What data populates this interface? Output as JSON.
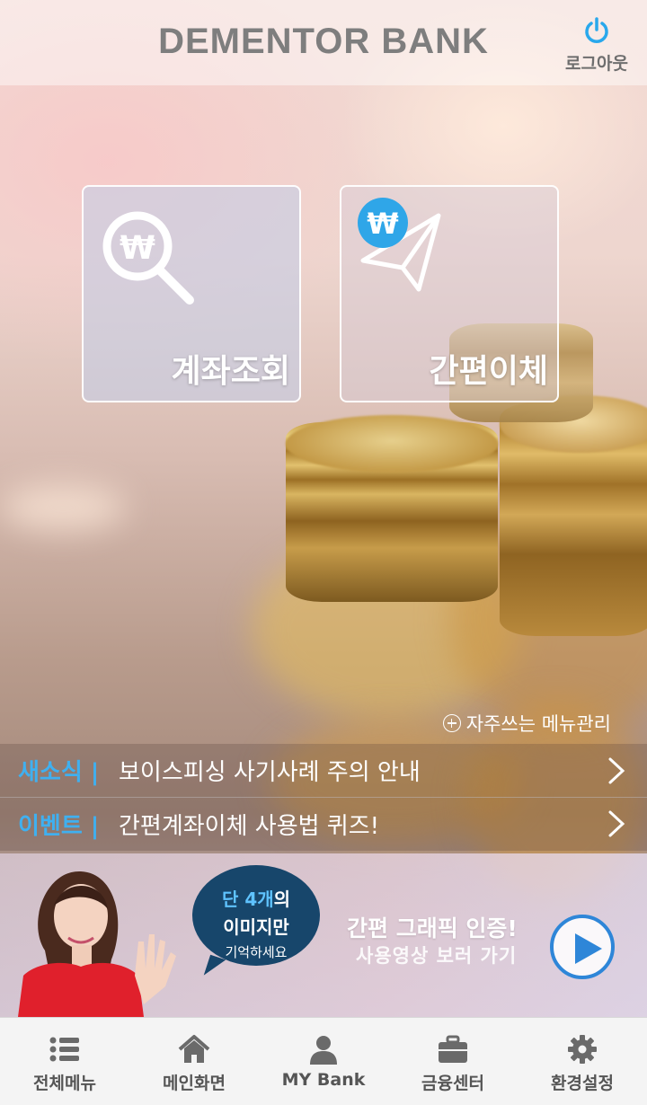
{
  "header": {
    "title": "DEMENTOR BANK",
    "logout_label": "로그아웃"
  },
  "tiles": {
    "account_inquiry": {
      "label": "계좌조회",
      "icon": "won-search-icon"
    },
    "quick_transfer": {
      "label": "간편이체",
      "icon": "won-paper-plane-icon"
    }
  },
  "frequent_menu": {
    "label": "자주쓰는 메뉴관리"
  },
  "news": {
    "tag": "새소식 |",
    "text": "보이스피싱 사기사례 주의 안내"
  },
  "event": {
    "tag": "이벤트 |",
    "text": "간편계좌이체 사용법 퀴즈!"
  },
  "banner": {
    "bubble_highlight": "단 4개",
    "bubble_line1_suffix": "의",
    "bubble_line2": "이미지만",
    "bubble_line3": "기억하세요",
    "title": "간편 그래픽 인증!",
    "subtitle": "사용영상 보러 가기"
  },
  "nav": {
    "items": [
      {
        "label": "전체메뉴",
        "icon": "list-icon"
      },
      {
        "label": "메인화면",
        "icon": "home-icon"
      },
      {
        "label": "MY Bank",
        "icon": "user-icon"
      },
      {
        "label": "금융센터",
        "icon": "briefcase-icon"
      },
      {
        "label": "환경설정",
        "icon": "gear-icon"
      }
    ]
  },
  "colors": {
    "accent_blue": "#3fb0f0",
    "bubble_navy": "#17466b",
    "play_blue": "#2e86d8"
  }
}
